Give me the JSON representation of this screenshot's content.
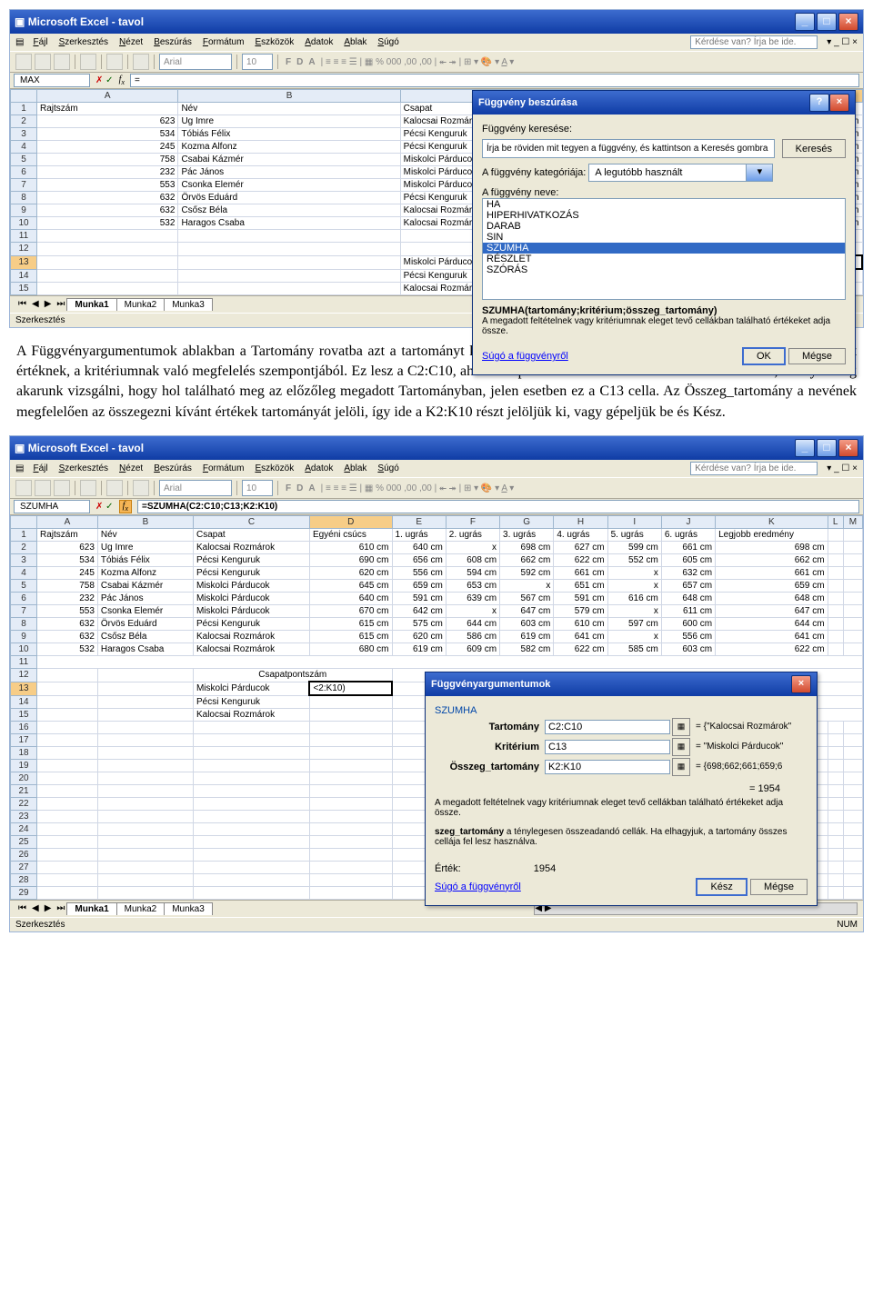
{
  "app_title": "Microsoft Excel - tavol",
  "menu": [
    "Fájl",
    "Szerkesztés",
    "Nézet",
    "Beszúrás",
    "Formátum",
    "Eszközök",
    "Adatok",
    "Ablak",
    "Súgó"
  ],
  "help_placeholder": "Kérdése van? Írja be ide.",
  "font_name": "Arial",
  "font_size": "10",
  "toolbar_fmt": [
    "F",
    "D",
    "A"
  ],
  "namebox1": "MAX",
  "formula1": "=",
  "namebox2": "SZUMHA",
  "formula2": "=SZUMHA(C2:C10;C13;K2:K10)",
  "cols1": [
    "A",
    "B",
    "C",
    "D"
  ],
  "cols2": [
    "A",
    "B",
    "C",
    "D",
    "E",
    "F",
    "G",
    "H",
    "I",
    "J",
    "K",
    "L",
    "M"
  ],
  "header_row": [
    "Rajtszám",
    "Név",
    "Csapat",
    "Egyéni csúcs",
    "1. ugrás",
    "2. ugrás",
    "3. ugrás",
    "4. ugrás",
    "5. ugrás",
    "6. ugrás",
    "Legjobb eredmény"
  ],
  "rows": [
    [
      "623",
      "Ug Imre",
      "Kalocsai Rozmárok",
      "610 cm",
      "640 cm",
      "x",
      "698 cm",
      "627 cm",
      "599 cm",
      "661 cm",
      "698 cm"
    ],
    [
      "534",
      "Tóbiás Félix",
      "Pécsi Kenguruk",
      "690 cm",
      "656 cm",
      "608 cm",
      "662 cm",
      "622 cm",
      "552 cm",
      "605 cm",
      "662 cm"
    ],
    [
      "245",
      "Kozma Alfonz",
      "Pécsi Kenguruk",
      "620 cm",
      "556 cm",
      "594 cm",
      "592 cm",
      "661 cm",
      "x",
      "632 cm",
      "661 cm"
    ],
    [
      "758",
      "Csabai Kázmér",
      "Miskolci Párducok",
      "645 cm",
      "659 cm",
      "653 cm",
      "x",
      "651 cm",
      "x",
      "657 cm",
      "659 cm"
    ],
    [
      "232",
      "Pác János",
      "Miskolci Párducok",
      "640 cm",
      "591 cm",
      "639 cm",
      "567 cm",
      "591 cm",
      "616 cm",
      "648 cm",
      "648 cm"
    ],
    [
      "553",
      "Csonka Elemér",
      "Miskolci Párducok",
      "670 cm",
      "642 cm",
      "x",
      "647 cm",
      "579 cm",
      "x",
      "611 cm",
      "647 cm"
    ],
    [
      "632",
      "Örvös Eduárd",
      "Pécsi Kenguruk",
      "615 cm",
      "575 cm",
      "644 cm",
      "603 cm",
      "610 cm",
      "597 cm",
      "600 cm",
      "644 cm"
    ],
    [
      "632",
      "Csősz Béla",
      "Kalocsai Rozmárok",
      "615 cm",
      "620 cm",
      "586 cm",
      "619 cm",
      "641 cm",
      "x",
      "556 cm",
      "641 cm"
    ],
    [
      "532",
      "Haragos Csaba",
      "Kalocsai Rozmárok",
      "680 cm",
      "619 cm",
      "609 cm",
      "582 cm",
      "622 cm",
      "585 cm",
      "603 cm",
      "622 cm"
    ]
  ],
  "merged12": "Csapatpontszám",
  "team13": "Miskolci Párducok",
  "formula_cell13": "=",
  "formula_cell13b": "<2:K10)",
  "team14": "Pécsi Kenguruk",
  "team15": "Kalocsai Rozmárok",
  "sheets": [
    "Munka1",
    "Munka2",
    "Munka3"
  ],
  "status_text": "Szerkesztés",
  "status_num": "NUM",
  "dlg1": {
    "title": "Függvény beszúrása",
    "search_label": "Függvény keresése:",
    "search_text": "Írja be röviden mit tegyen a függvény, és kattintson a Keresés gombra",
    "search_btn": "Keresés",
    "cat_label": "A függvény kategóriája:",
    "cat_value": "A legutóbb használt",
    "name_label": "A függvény neve:",
    "funcs": [
      "HA",
      "HIPERHIVATKOZÁS",
      "DARAB",
      "SIN",
      "SZUMHA",
      "RÉSZLET",
      "SZÓRÁS"
    ],
    "sig": "SZUMHA(tartomány;kritérium;összeg_tartomány)",
    "desc": "A megadott feltételnek vagy kritériumnak eleget tevő cellákban található értékeket adja össze.",
    "helplink": "Súgó a függvényről",
    "ok": "OK",
    "cancel": "Mégse"
  },
  "dlg2": {
    "title": "Függvényargumentumok",
    "fname": "SZUMHA",
    "args": [
      {
        "label": "Tartomány",
        "val": "C2:C10",
        "res": "= {\"Kalocsai Rozmárok\""
      },
      {
        "label": "Kritérium",
        "val": "C13",
        "res": "= \"Miskolci Párducok\""
      },
      {
        "label": "Összeg_tartomány",
        "val": "K2:K10",
        "res": "= {698;662;661;659;6"
      }
    ],
    "result_eq": "= 1954",
    "desc": "A megadott feltételnek vagy kritériumnak eleget tevő cellákban található értékeket adja össze.",
    "argdesc_label": "szeg_tartomány",
    "argdesc": "a ténylegesen összeadandó cellák. Ha elhagyjuk, a tartomány összes cellája fel lesz használva.",
    "val_label": "Érték:",
    "val": "1954",
    "helplink": "Súgó a függvényről",
    "ok": "Kész",
    "cancel": "Mégse"
  },
  "paragraph": "A Függvényargumentumok ablakban a Tartomány rovatba azt a tartományt kell kijelölni vagy beírni, amelyet ki akarunk értékelni egy adott értéknek, a kritériumnak való megfelelés szempontjából. Ez lesz a C2:C10, ahol a csapatnevek találhatóak. A Kritérium az a cella, amelyet meg akarunk vizsgálni, hogy hol található meg az előzőleg megadott Tartományban, jelen esetben ez a C13 cella. Az Összeg_tartomány a nevének megfelelően az összegezni kívánt értékek tartományát jelöli, így ide a K2:K10 részt jelöljük ki, vagy gépeljük be és Kész."
}
